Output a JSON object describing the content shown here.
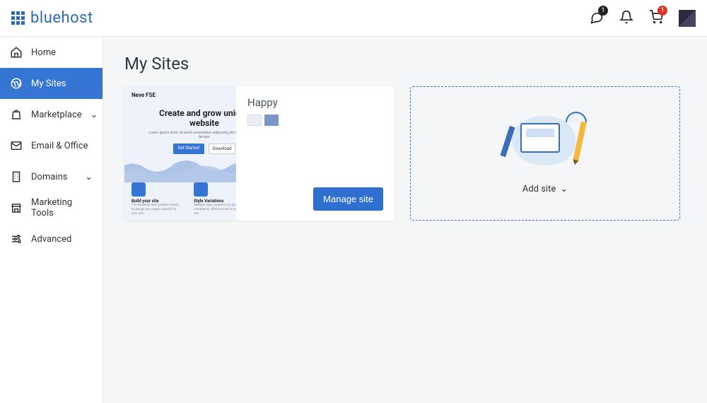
{
  "brand": "bluehost",
  "topbar": {
    "chat_badge": "1",
    "cart_badge": "1"
  },
  "sidebar": {
    "items": [
      {
        "label": "Home"
      },
      {
        "label": "My Sites"
      },
      {
        "label": "Marketplace"
      },
      {
        "label": "Email & Office"
      },
      {
        "label": "Domains"
      },
      {
        "label": "Marketing Tools"
      },
      {
        "label": "Advanced"
      }
    ]
  },
  "page": {
    "title": "My Sites"
  },
  "sites": [
    {
      "name": "Happy",
      "preview": {
        "theme_label": "Neve FSE",
        "headline": "Create and grow unique website",
        "sub": "Lorem ipsum dolor sit amet consectetur adipiscing elit sed do eiusmod tempor",
        "cta_primary": "Get Started",
        "cta_secondary": "Download",
        "features": [
          {
            "title": "Build your site",
            "desc": "The flexibility and creative control to design your pages exactly for your site."
          },
          {
            "title": "Style Variations",
            "desc": "Multiple style variations to give a completely different look to your site."
          }
        ]
      },
      "manage_label": "Manage site"
    }
  ],
  "add_site": {
    "label": "Add site"
  }
}
